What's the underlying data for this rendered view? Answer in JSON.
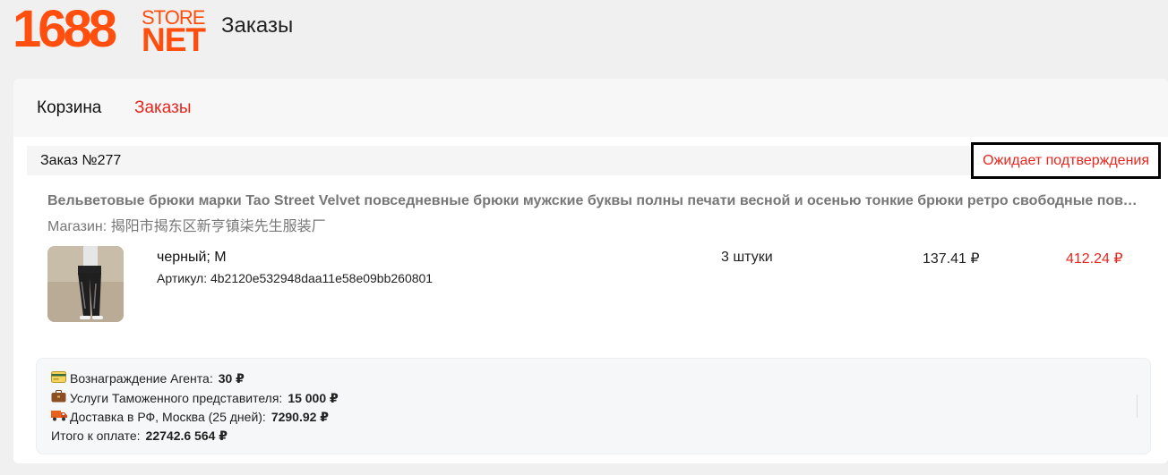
{
  "logo": {
    "number": "1688",
    "store": "STORE",
    "net": "NET"
  },
  "page_title": "Заказы",
  "tabs": [
    {
      "label": "Корзина",
      "active": false
    },
    {
      "label": "Заказы",
      "active": true
    }
  ],
  "order": {
    "number_label": "Заказ №277",
    "status": "Ожидает подтверждения",
    "product_title": "Вельветовые брюки марки Tao Street Velvet повседневные брюки мужские буквы полны печати весной и осенью тонкие брюки ретро свободные повседневные брюки",
    "shop": "Магазин: 揭阳市揭东区新亨镇柒先生服装厂",
    "item": {
      "variant": "черный; M",
      "sku": "Артикул: 4b2120e532948daa11e58e09bb260801",
      "quantity": "3 штуки",
      "unit_price": "137.41 ₽",
      "total_price": "412.24 ₽"
    }
  },
  "summary": {
    "agent_fee": {
      "icon": "credit-card-icon",
      "label": "Вознаграждение Агента:",
      "value": "30 ₽"
    },
    "customs": {
      "icon": "briefcase-icon",
      "label": "Услуги Таможенного представителя:",
      "value": "15 000 ₽"
    },
    "delivery": {
      "icon": "truck-icon",
      "label": "Доставка в РФ, Москва (25 дней):",
      "value": "7290.92 ₽"
    },
    "total": {
      "label": "Итого к оплате:",
      "value": "22742.6 564 ₽"
    }
  },
  "colors": {
    "brand": "#ff4e0d",
    "accent_red": "#e8261e"
  }
}
